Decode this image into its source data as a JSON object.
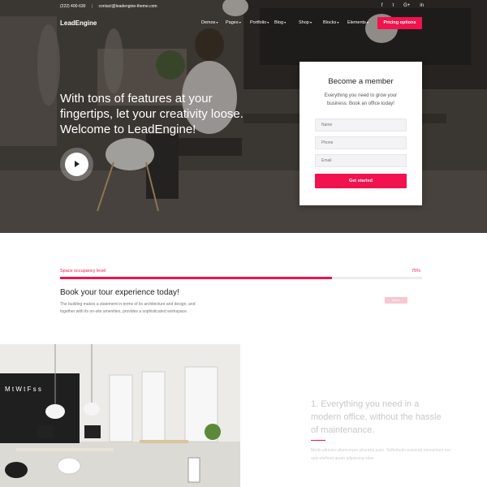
{
  "colors": {
    "accent": "#f0134e",
    "accent_light": "#f9c6d3"
  },
  "topbar": {
    "phone": "(222) 400-630",
    "email": "contact@leadengine-theme.com"
  },
  "social": [
    "f",
    "t",
    "G+",
    "in"
  ],
  "header": {
    "logo": "LeadEngine",
    "nav": [
      "Demos",
      "Pages",
      "Portfolio",
      "Blog",
      "Shop",
      "Blocks",
      "Elements"
    ],
    "cta": "Pricing options"
  },
  "hero": {
    "title": "With tons of features at your fingertips, let your creativity loose. Welcome to LeadEngine!",
    "play_icon": "play-icon"
  },
  "signup": {
    "title": "Become a member",
    "text": "Everything you need to grow your business. Book an office today!",
    "name_placeholder": "Name",
    "phone_placeholder": "Phone",
    "email_placeholder": "Email",
    "button": "Get started"
  },
  "progress": {
    "label": "Space occupancy level",
    "percent_text": "75%",
    "value": 0.75
  },
  "tour": {
    "title": "Book your tour experience today!",
    "text": "The building makes a statement in terms of its architecture and design, and together with its on-site amenities, provides a sophisticated workspace.",
    "button": "Button"
  },
  "feature": {
    "title": "1. Everything you need in a modern office, without the hassle of maintenance.",
    "text": "Morbi ultricies ullamcorper pharetra justo. Sollicitudin euismod elementum nec quis eleifend quam adipiscing vitae."
  }
}
